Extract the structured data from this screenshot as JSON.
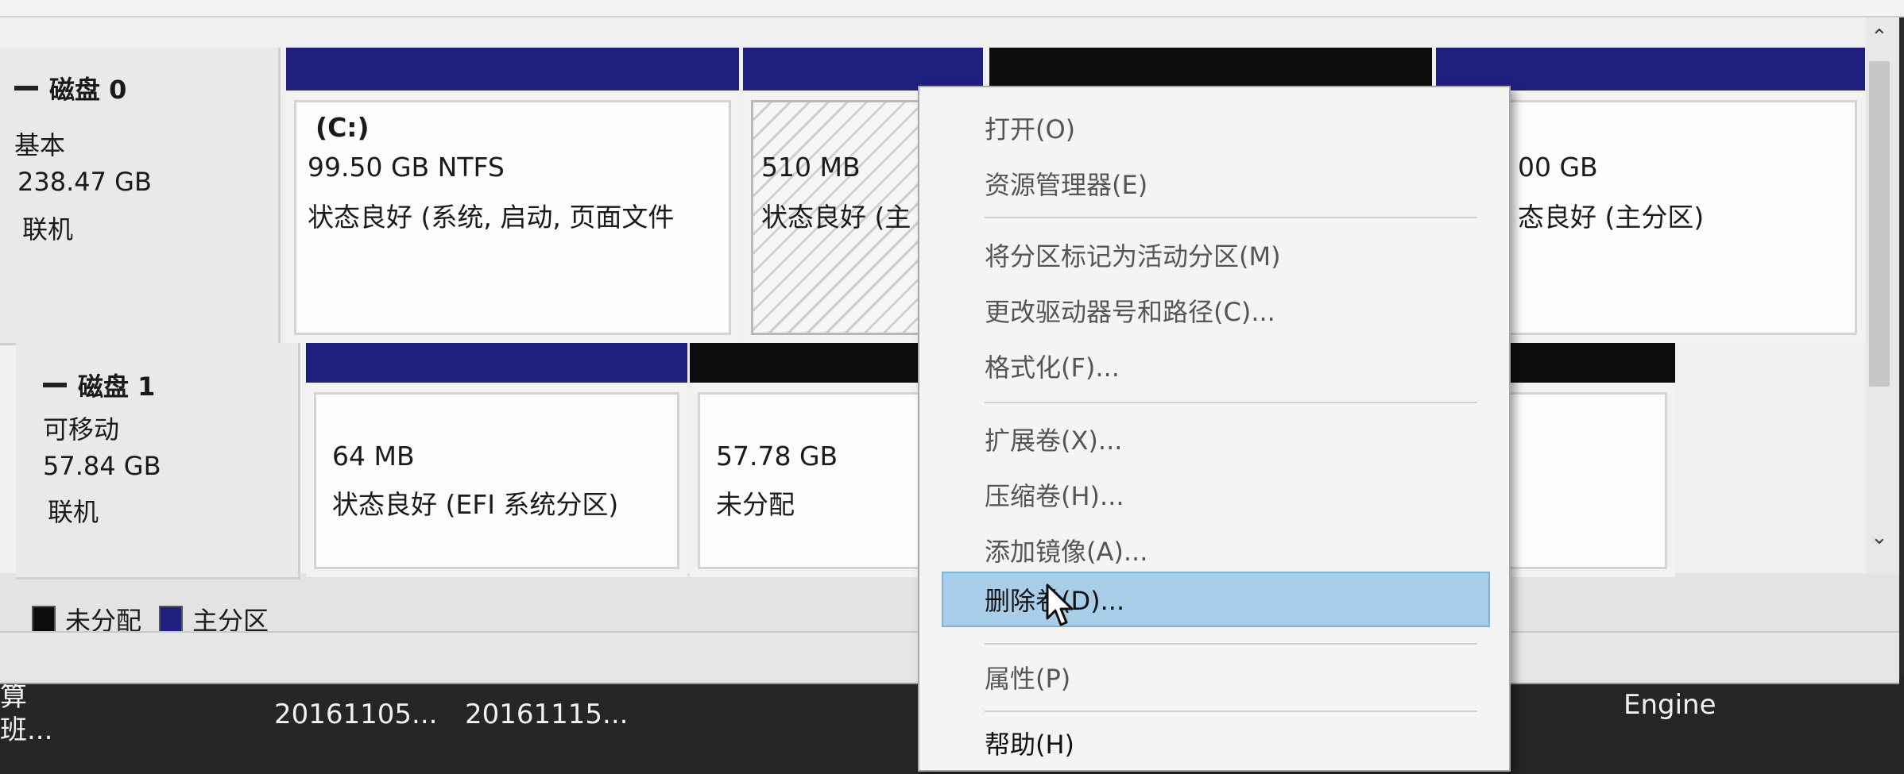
{
  "disks": [
    {
      "name": "磁盘 0",
      "type": "基本",
      "size": "238.47 GB",
      "status": "联机",
      "partitions": [
        {
          "label": "(C:)",
          "size": "99.50 GB NTFS",
          "status": "状态良好 (系统, 启动, 页面文件",
          "kind": "primary"
        },
        {
          "label": "",
          "size": "510 MB",
          "status": "状态良好 (主",
          "kind": "primary"
        },
        {
          "label": "",
          "size": "",
          "status": "",
          "kind": "unallocated"
        },
        {
          "label": "",
          "size": "00 GB",
          "status": "态良好 (主分区)",
          "kind": "primary"
        }
      ]
    },
    {
      "name": "磁盘 1",
      "type": "可移动",
      "size": "57.84 GB",
      "status": "联机",
      "partitions": [
        {
          "label": "",
          "size": "64 MB",
          "status": "状态良好 (EFI 系统分区)",
          "kind": "primary"
        },
        {
          "label": "",
          "size": "57.78 GB",
          "status": "未分配",
          "kind": "unallocated"
        }
      ]
    }
  ],
  "legend": {
    "unallocated": "未分配",
    "primary": "主分区",
    "unallocated_color": "#0d0d0d",
    "primary_color": "#1f1f80"
  },
  "context_menu": {
    "items": [
      {
        "label": "打开(O)",
        "enabled": false
      },
      {
        "label": "资源管理器(E)",
        "enabled": false
      },
      {
        "label": "将分区标记为活动分区(M)",
        "enabled": false
      },
      {
        "label": "更改驱动器号和路径(C)...",
        "enabled": false
      },
      {
        "label": "格式化(F)...",
        "enabled": false
      },
      {
        "label": "扩展卷(X)...",
        "enabled": false
      },
      {
        "label": "压缩卷(H)...",
        "enabled": false
      },
      {
        "label": "添加镜像(A)...",
        "enabled": false
      },
      {
        "label": "删除卷(D)...",
        "enabled": true,
        "highlighted": true
      },
      {
        "label": "属性(P)",
        "enabled": false
      },
      {
        "label": "帮助(H)",
        "enabled": true
      }
    ]
  },
  "desktop": {
    "items": [
      "算",
      "班...",
      "20161105...",
      "20161115...",
      "Engine"
    ]
  },
  "icons": {
    "collapse": "minus-collapse-icon",
    "cursor": "mouse-pointer-icon",
    "scroll_up": "chevron-up-icon",
    "scroll_down": "chevron-down-icon"
  }
}
